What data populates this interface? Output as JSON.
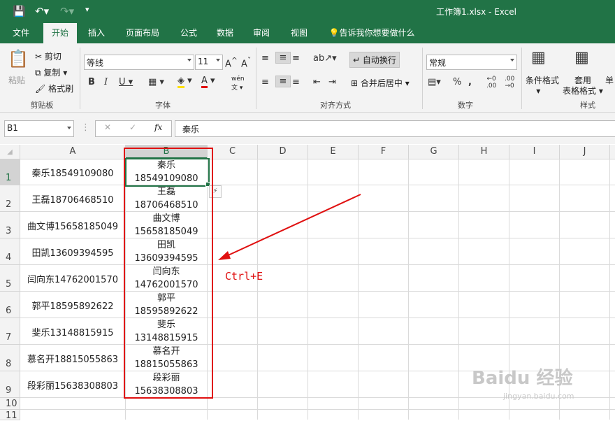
{
  "window": {
    "title": "工作簿1.xlsx  -  Excel"
  },
  "tabs": [
    "文件",
    "开始",
    "插入",
    "页面布局",
    "公式",
    "数据",
    "审阅",
    "视图"
  ],
  "tell_me": "告诉我你想要做什么",
  "clipboard": {
    "paste": "粘贴",
    "cut": "剪切",
    "copy": "复制",
    "format_painter": "格式刷",
    "label": "剪贴板"
  },
  "font": {
    "name": "等线",
    "size": "11",
    "label": "字体",
    "pinyin": "wén"
  },
  "alignment": {
    "wrap": "自动换行",
    "merge": "合并后居中",
    "label": "对齐方式"
  },
  "number": {
    "format": "常规",
    "label": "数字"
  },
  "styles": {
    "conditional": "条件格式",
    "table_a": "套用",
    "table_b": "表格格式",
    "cell": "单",
    "label": "样式"
  },
  "formula_bar": {
    "name_box": "B1",
    "fx": "fx",
    "content": "秦乐"
  },
  "columns": [
    "A",
    "B",
    "C",
    "D",
    "E",
    "F",
    "G",
    "H",
    "I",
    "J"
  ],
  "rows": [
    "1",
    "2",
    "3",
    "4",
    "5",
    "6",
    "7",
    "8",
    "9",
    "10",
    "11"
  ],
  "col_a": [
    "秦乐18549109080",
    "王磊18706468510",
    "曲文博15658185049",
    "田凯13609394595",
    "闫向东14762001570",
    "郭平18595892622",
    "斐乐13148815915",
    "慕名开18815055863",
    "段彩丽15638308803"
  ],
  "col_b": [
    {
      "name": "秦乐",
      "phone": "18549109080"
    },
    {
      "name": "王磊",
      "phone": "18706468510"
    },
    {
      "name": "曲文博",
      "phone": "15658185049"
    },
    {
      "name": "田凯",
      "phone": "13609394595"
    },
    {
      "name": "闫向东",
      "phone": "14762001570"
    },
    {
      "name": "郭平",
      "phone": "18595892622"
    },
    {
      "name": "斐乐",
      "phone": "13148815915"
    },
    {
      "name": "慕名开",
      "phone": "18815055863"
    },
    {
      "name": "段彩丽",
      "phone": "15638308803"
    }
  ],
  "annotation": "Ctrl+E",
  "watermark": {
    "main": "Baidu 经验",
    "sub": "jingyan.baidu.com"
  },
  "colors": {
    "excel_green": "#217346",
    "annotation_red": "#e01010"
  }
}
